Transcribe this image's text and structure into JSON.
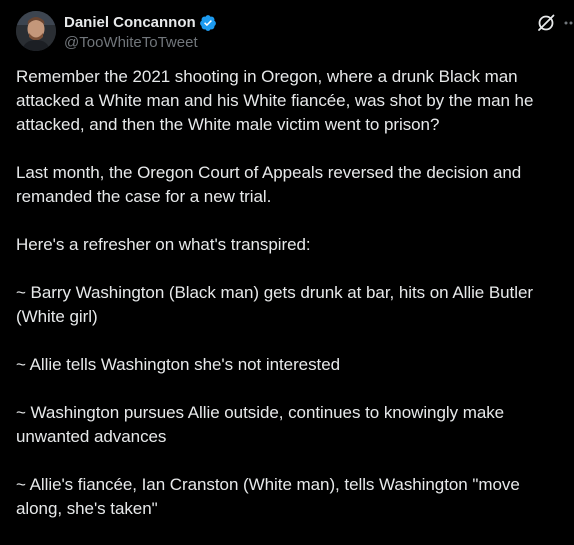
{
  "author": {
    "display_name": "Daniel Concannon",
    "handle": "@TooWhiteToTweet",
    "verified_color": "#1d9bf0"
  },
  "actions": {
    "grok_icon": "grok-slash-icon",
    "more_icon": "more-dots-icon"
  },
  "tweet": {
    "paragraphs": [
      "Remember the 2021 shooting in Oregon, where a drunk Black man attacked a White man and his White fiancée, was shot by the man he attacked, and then the White male victim went to prison?",
      "Last month, the Oregon Court of Appeals reversed the decision and remanded the case for a new trial.",
      "Here's a refresher on what's transpired:",
      "~ Barry Washington (Black man) gets drunk at bar, hits on Allie Butler (White girl)",
      "~ Allie tells Washington she's not interested",
      "~ Washington pursues Allie outside, continues to knowingly make unwanted advances",
      "~ Allie's fiancée, Ian Cranston (White man), tells Washington \"move along, she's taken\""
    ]
  },
  "colors": {
    "background": "#000000",
    "text": "#e7e9ea",
    "secondary": "#71767b",
    "accent": "#1d9bf0"
  }
}
